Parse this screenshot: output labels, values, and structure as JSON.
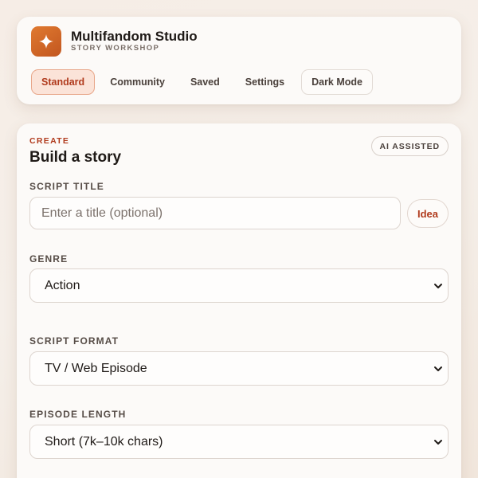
{
  "header": {
    "app_title": "Multifandom Studio",
    "app_subtitle": "STORY WORKSHOP",
    "icon": "sparkle-icon",
    "nav": [
      {
        "label": "Standard",
        "active": true
      },
      {
        "label": "Community"
      },
      {
        "label": "Saved"
      },
      {
        "label": "Settings"
      },
      {
        "label": "Dark Mode"
      }
    ]
  },
  "builder": {
    "eyebrow": "CREATE",
    "title": "Build a story",
    "badge": "AI ASSISTED",
    "script_title": {
      "label": "SCRIPT TITLE",
      "placeholder": "Enter a title (optional)",
      "value": "",
      "idea_button": "Idea"
    },
    "genre": {
      "label": "GENRE",
      "value": "Action"
    },
    "format": {
      "label": "SCRIPT FORMAT",
      "value": "TV / Web Episode"
    },
    "length": {
      "label": "EPISODE LENGTH",
      "value": "Short (7k–10k chars)"
    }
  },
  "colors": {
    "accent": "#b03a1c",
    "icon_gradient_start": "#e07a30",
    "icon_gradient_end": "#c2561f",
    "active_tab_bg": "#fbe3d8"
  }
}
